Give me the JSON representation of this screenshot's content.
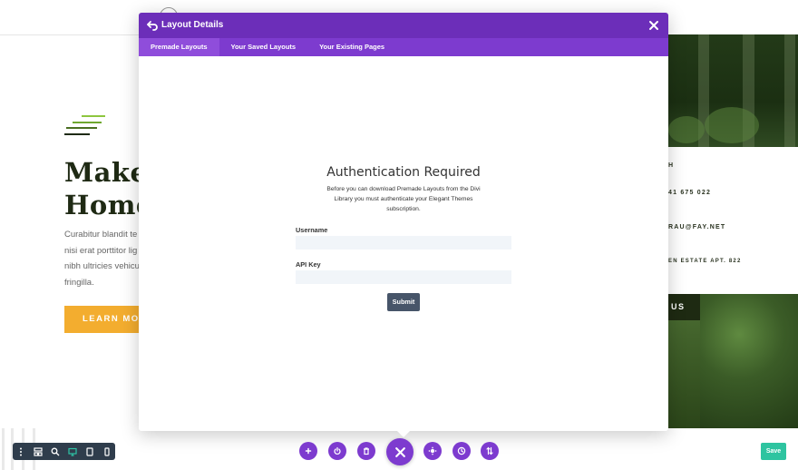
{
  "background": {
    "hero_title": "Make Y\nHome",
    "hero_text": "Curabitur blandit te\nnisi erat porttitor lig\nnibh ultricies vehicu\nfringilla.",
    "learn_more_label": "LEARN MORE",
    "contact_lines": [
      "H",
      "41 675 022",
      "RAU@FAY.NET",
      "EN ESTATE APT. 822"
    ],
    "contact_us_label": "US",
    "logo_colors": [
      "#8dc63f",
      "#6fa82f",
      "#4a6f21",
      "#1e2a12"
    ]
  },
  "modal": {
    "title": "Layout Details",
    "tabs": [
      {
        "label": "Premade Layouts",
        "active": true
      },
      {
        "label": "Your Saved Layouts",
        "active": false
      },
      {
        "label": "Your Existing Pages",
        "active": false
      }
    ],
    "auth": {
      "title": "Authentication Required",
      "description": "Before you can download Premade Layouts from the Divi Library you must authenticate your Elegant Themes subscription.",
      "username_label": "Username",
      "username_value": "",
      "api_key_label": "API Key",
      "api_key_value": "",
      "submit_label": "Submit"
    },
    "header_color": "#6c2eb9",
    "tabs_color": "#7d3bcf"
  },
  "toolbar": {
    "view_icons": [
      "menu-dots-icon",
      "wireframe-icon",
      "zoom-icon",
      "desktop-icon",
      "tablet-icon",
      "phone-icon"
    ],
    "active_view": "desktop-icon",
    "action_icons": [
      "add-icon",
      "power-icon",
      "trash-icon",
      "close-icon",
      "settings-icon",
      "history-icon",
      "sort-icon"
    ],
    "save_label": "Save",
    "accent_color": "#7d3bcf",
    "save_color": "#2ec4a0"
  }
}
